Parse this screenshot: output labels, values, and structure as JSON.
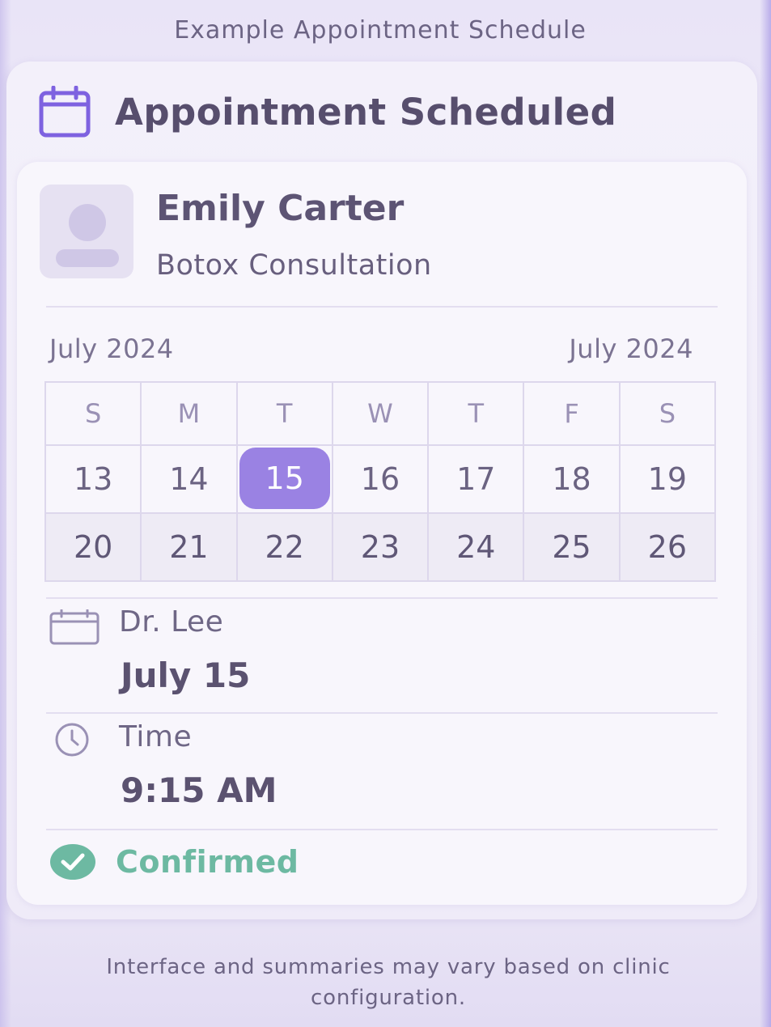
{
  "page": {
    "caption": "Example Appointment Schedule",
    "footer": "Interface and summaries may vary based on clinic configuration."
  },
  "card": {
    "header_icon": "calendar-icon",
    "title": "Appointment Scheduled"
  },
  "patient": {
    "avatar_icon": "user-avatar-icon",
    "name": "Emily Carter",
    "service": "Botox Consultation"
  },
  "calendar": {
    "month_left": "July 2024",
    "month_right": "July 2024",
    "weekdays": [
      "S",
      "M",
      "T",
      "W",
      "T",
      "F",
      "S"
    ],
    "weeks": [
      [
        "13",
        "14",
        "15",
        "16",
        "17",
        "18",
        "19"
      ],
      [
        "20",
        "21",
        "22",
        "23",
        "24",
        "25",
        "26"
      ]
    ],
    "selected_day": "15",
    "selected_color": "#9a82e3"
  },
  "details": {
    "provider": {
      "icon": "calendar-icon",
      "label": "Dr. Lee",
      "value": "July 15"
    },
    "time": {
      "icon": "clock-icon",
      "label": "Time",
      "value": "9:15 AM"
    }
  },
  "status": {
    "icon": "check-circle-icon",
    "label": "Confirmed",
    "color": "#6db9a2"
  },
  "colors": {
    "accent": "#7e62e0",
    "background": "#ece7f7"
  }
}
